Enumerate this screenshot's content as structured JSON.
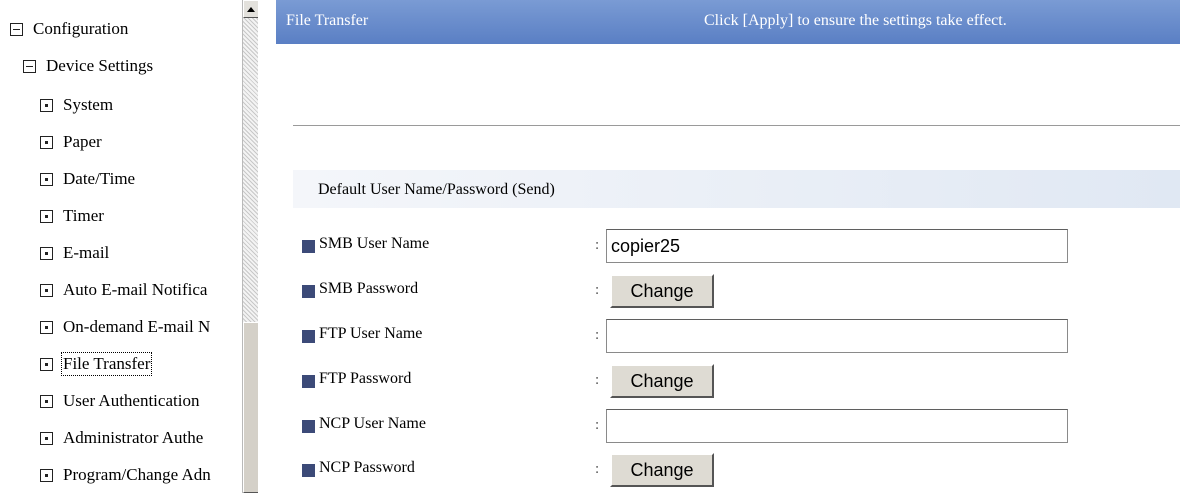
{
  "nav": {
    "items": [
      {
        "label": "Configuration",
        "toggle": "minus"
      },
      {
        "label": "Device Settings",
        "toggle": "minus"
      },
      {
        "label": "System",
        "toggle": "dot"
      },
      {
        "label": "Paper",
        "toggle": "dot"
      },
      {
        "label": "Date/Time",
        "toggle": "dot"
      },
      {
        "label": "Timer",
        "toggle": "dot"
      },
      {
        "label": "E-mail",
        "toggle": "dot"
      },
      {
        "label": "Auto E-mail Notifica",
        "toggle": "dot"
      },
      {
        "label": "On-demand E-mail N",
        "toggle": "dot"
      },
      {
        "label": "File Transfer",
        "toggle": "dot",
        "selected": true
      },
      {
        "label": "User Authentication",
        "toggle": "dot"
      },
      {
        "label": "Administrator Authe",
        "toggle": "dot"
      },
      {
        "label": "Program/Change Adn",
        "toggle": "dot"
      }
    ]
  },
  "header": {
    "title": "File Transfer",
    "apply_hint": "Click [Apply] to ensure the settings take effect."
  },
  "section": {
    "title": "Default User Name/Password (Send)"
  },
  "form": {
    "separator": ":",
    "rows": [
      {
        "label": "SMB User Name",
        "type": "text",
        "value": "copier25"
      },
      {
        "label": "SMB Password",
        "type": "button",
        "button_label": "Change"
      },
      {
        "label": "FTP User Name",
        "type": "text",
        "value": ""
      },
      {
        "label": "FTP Password",
        "type": "button",
        "button_label": "Change"
      },
      {
        "label": "NCP User Name",
        "type": "text",
        "value": ""
      },
      {
        "label": "NCP Password",
        "type": "button",
        "button_label": "Change"
      }
    ]
  },
  "colors": {
    "titlebar": "#5a7fc4",
    "marker": "#3c4a78"
  }
}
